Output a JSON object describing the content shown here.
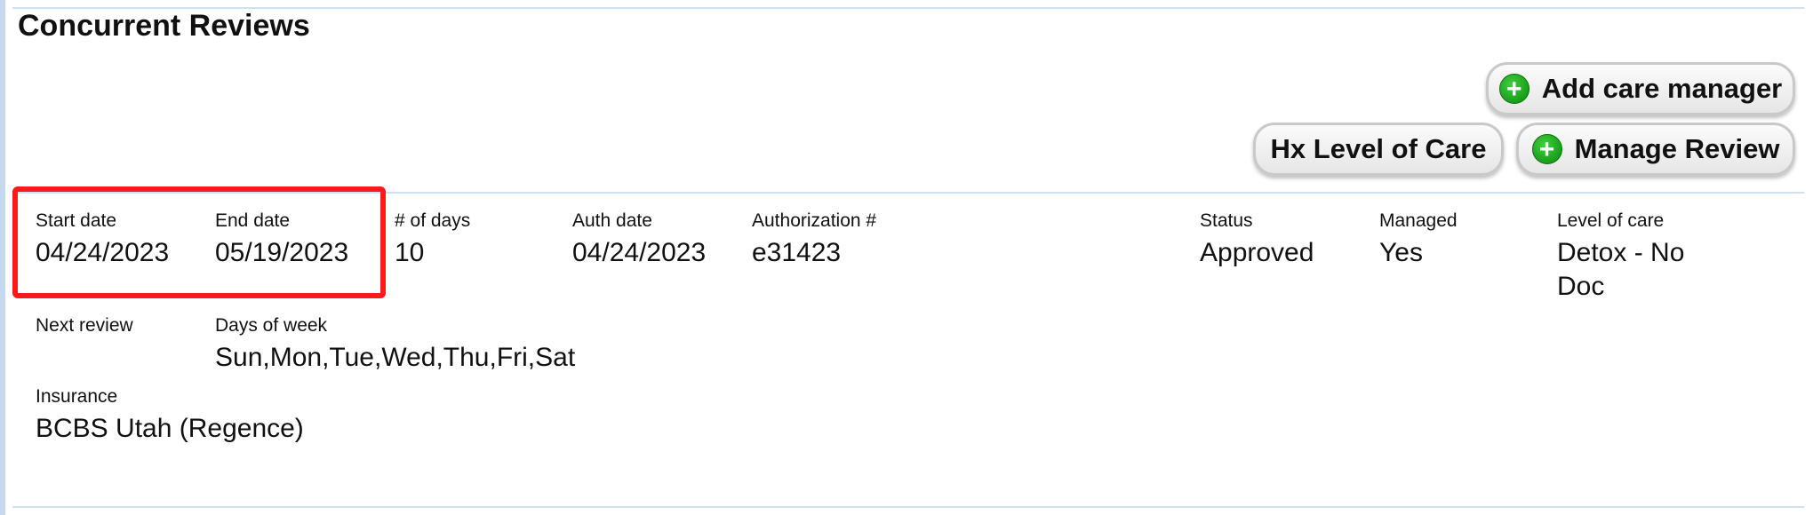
{
  "section": {
    "title": "Concurrent Reviews"
  },
  "buttons": {
    "add_care_manager": {
      "label": "Add care manager",
      "icon": "plus-circle-icon"
    },
    "hx_level_of_care": {
      "label": "Hx Level of Care"
    },
    "manage_review": {
      "label": "Manage Review",
      "icon": "plus-circle-icon"
    }
  },
  "review": {
    "start_date": {
      "label": "Start date",
      "value": "04/24/2023"
    },
    "end_date": {
      "label": "End date",
      "value": "05/19/2023"
    },
    "num_days": {
      "label": "# of days",
      "value": "10"
    },
    "auth_date": {
      "label": "Auth date",
      "value": "04/24/2023"
    },
    "authorization": {
      "label": "Authorization #",
      "value": "e31423"
    },
    "status": {
      "label": "Status",
      "value": "Approved"
    },
    "managed": {
      "label": "Managed",
      "value": "Yes"
    },
    "level_of_care": {
      "label": "Level of care",
      "value_line1": "Detox - No",
      "value_line2": "Doc"
    },
    "next_review": {
      "label": "Next review",
      "value": ""
    },
    "days_of_week": {
      "label": "Days of week",
      "value": "Sun,Mon,Tue,Wed,Thu,Fri,Sat"
    },
    "insurance": {
      "label": "Insurance",
      "value": "BCBS Utah (Regence)"
    }
  },
  "colors": {
    "accent_rule": "#cfe0f2",
    "highlight": "#ff1a1a",
    "plus_icon": "#119911"
  }
}
